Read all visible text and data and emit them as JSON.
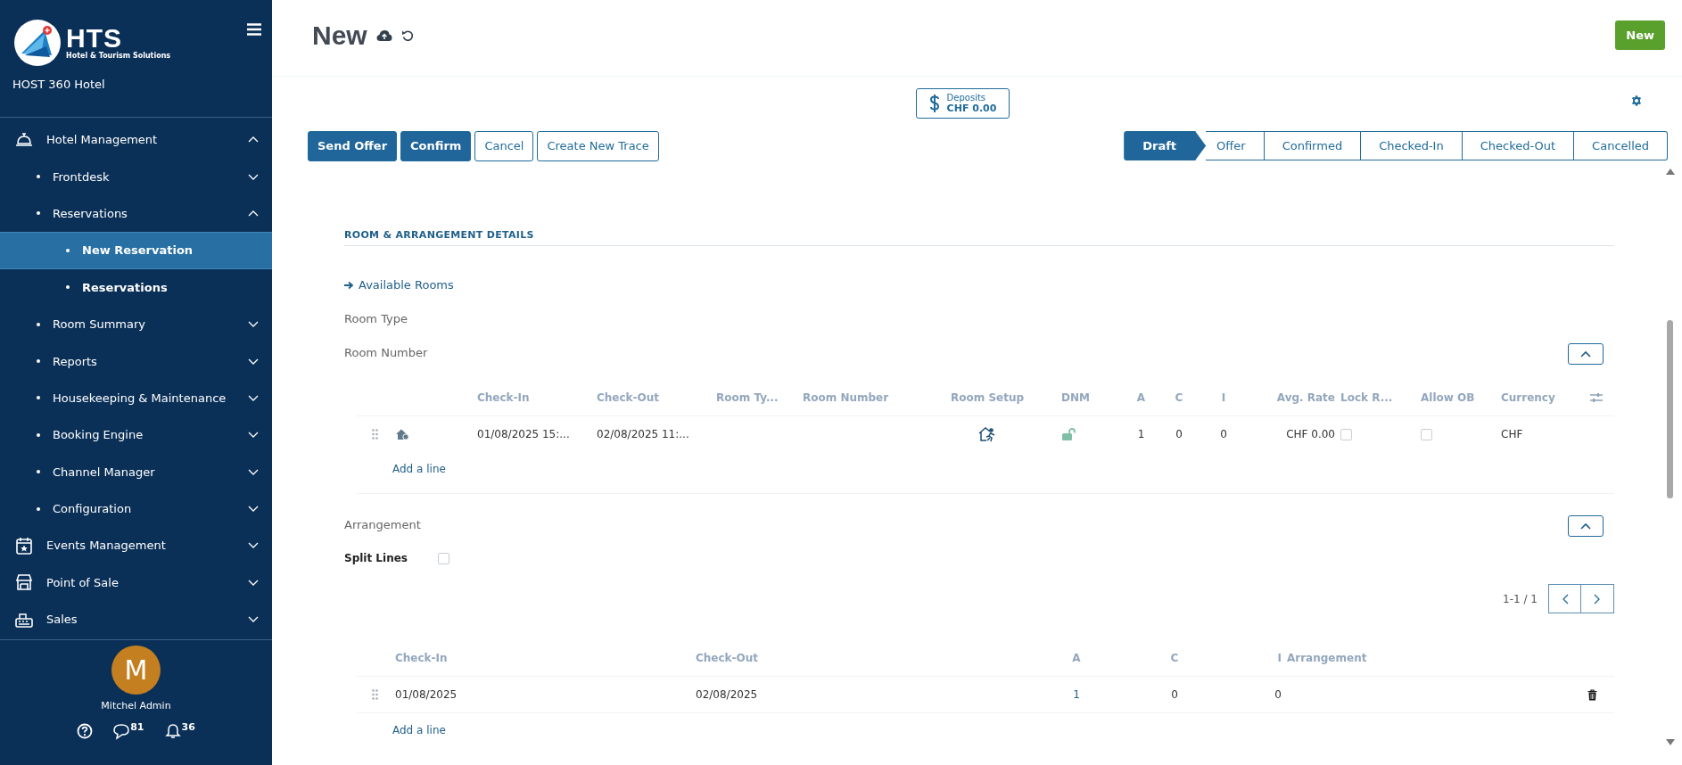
{
  "sidebar": {
    "logo": {
      "name": "HTS",
      "tagline": "Hotel & Tourism Solutions"
    },
    "hotel": "HOST 360 Hotel",
    "menu": [
      {
        "label": "Hotel Management",
        "selected": false,
        "expanded": true,
        "children": [
          {
            "label": "Frontdesk",
            "selected": false,
            "expanded": false
          },
          {
            "label": "Reservations",
            "selected": false,
            "expanded": true,
            "children": [
              {
                "label": "New Reservation",
                "selected": true
              },
              {
                "label": "Reservations",
                "selected": false
              }
            ]
          },
          {
            "label": "Room Summary",
            "selected": false,
            "expanded": false
          },
          {
            "label": "Reports",
            "selected": false,
            "expanded": false
          },
          {
            "label": "Housekeeping & Maintenance",
            "selected": false,
            "expanded": false
          },
          {
            "label": "Booking Engine",
            "selected": false,
            "expanded": false
          },
          {
            "label": "Channel Manager",
            "selected": false,
            "expanded": false
          },
          {
            "label": "Configuration",
            "selected": false,
            "expanded": false
          }
        ]
      },
      {
        "label": "Events Management",
        "selected": false,
        "expanded": false
      },
      {
        "label": "Point of Sale",
        "selected": false,
        "expanded": false
      },
      {
        "label": "Sales",
        "selected": false,
        "expanded": false
      }
    ],
    "user": {
      "initial": "M",
      "name": "Mitchel Admin",
      "messages": "81",
      "notifications": "36"
    }
  },
  "header": {
    "title": "New",
    "new_button": "New"
  },
  "deposits": {
    "label": "Deposits",
    "amount": "CHF 0.00"
  },
  "actions": [
    {
      "label": "Send Offer",
      "kind": "primary"
    },
    {
      "label": "Confirm",
      "kind": "primary"
    },
    {
      "label": "Cancel",
      "kind": "secondary"
    },
    {
      "label": "Create New Trace",
      "kind": "secondary"
    }
  ],
  "status_steps": [
    {
      "label": "Draft",
      "selected": true
    },
    {
      "label": "Offer",
      "selected": false
    },
    {
      "label": "Confirmed",
      "selected": false
    },
    {
      "label": "Checked-In",
      "selected": false
    },
    {
      "label": "Checked-Out",
      "selected": false
    },
    {
      "label": "Cancelled",
      "selected": false
    }
  ],
  "section": {
    "title": "ROOM & ARRANGEMENT DETAILS",
    "available_rooms": "Available Rooms",
    "fields": [
      "Room Type",
      "Room Number"
    ],
    "rooms_table": {
      "columns": [
        "Check-In",
        "Check-Out",
        "Room Ty...",
        "Room Number",
        "Room Setup",
        "DNM",
        "A",
        "C",
        "I",
        "Avg. Rate",
        "Lock R...",
        "Allow OB",
        "Currency"
      ],
      "rows": [
        {
          "cells": [
            {
              "kind": "text",
              "text": "01/08/2025 15:..."
            },
            {
              "kind": "text",
              "text": "02/08/2025 11:..."
            },
            {
              "kind": "empty"
            },
            {
              "kind": "empty"
            },
            {
              "kind": "icon"
            },
            {
              "kind": "lock",
              "locked": false
            },
            {
              "kind": "text",
              "text": "1"
            },
            {
              "kind": "text",
              "text": "0"
            },
            {
              "kind": "text",
              "text": "0"
            },
            {
              "kind": "text",
              "text": "CHF 0.00"
            },
            {
              "kind": "checkbox",
              "checked": false
            },
            {
              "kind": "checkbox",
              "checked": false
            },
            {
              "kind": "text",
              "text": "CHF"
            }
          ]
        }
      ],
      "add_line": "Add a line"
    },
    "arrangement_label": "Arrangement",
    "split_lines": {
      "label": "Split Lines",
      "checked": false
    },
    "pager": "1-1 / 1",
    "arrangement_table": {
      "columns": [
        "Check-In",
        "Check-Out",
        "A",
        "C",
        "I",
        "Arrangement"
      ],
      "rows": [
        {
          "cells": [
            {
              "kind": "text",
              "text": "01/08/2025"
            },
            {
              "kind": "text",
              "text": "02/08/2025"
            },
            {
              "kind": "link",
              "text": "1"
            },
            {
              "kind": "text",
              "text": "0"
            },
            {
              "kind": "text",
              "text": "0"
            },
            {
              "kind": "empty"
            }
          ]
        }
      ],
      "add_line": "Add a line"
    }
  }
}
